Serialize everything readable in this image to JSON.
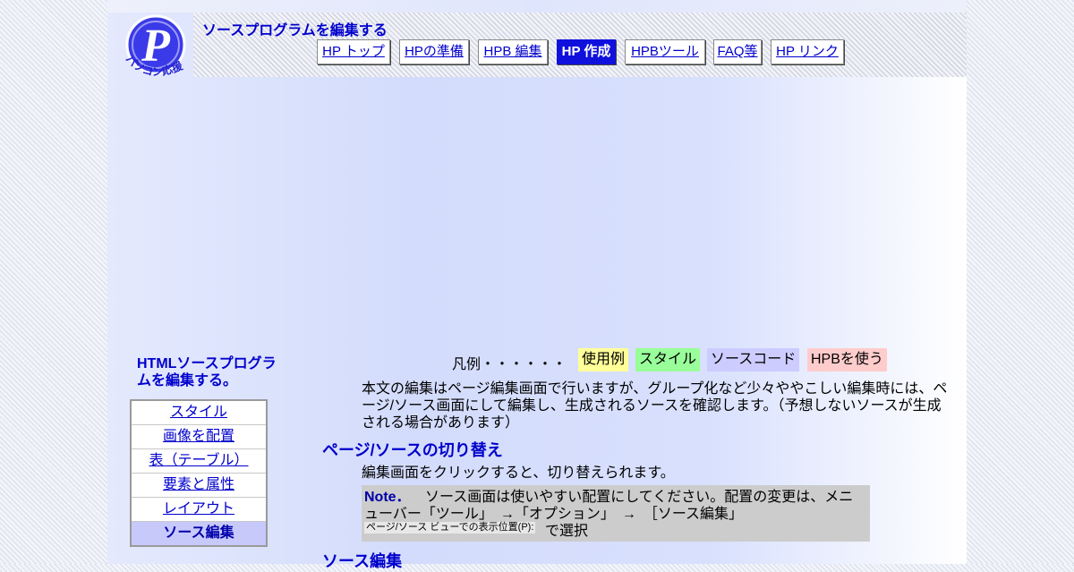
{
  "site": {
    "title": "ソースプログラムを編集する",
    "logo_text": "パソコン応援隊",
    "logo_letter": "P"
  },
  "nav": [
    {
      "label": "HP トップ",
      "active": false
    },
    {
      "label": "HPの準備",
      "active": false
    },
    {
      "label": "HPB 編集",
      "active": false
    },
    {
      "label": "HP 作成",
      "active": true
    },
    {
      "label": "HPBツール",
      "active": false
    },
    {
      "label": "FAQ等",
      "active": false
    },
    {
      "label": "HP リンク",
      "active": false
    }
  ],
  "sidebar": {
    "title": "HTMLソースプログラムを編集する。",
    "items": [
      {
        "label": "スタイル",
        "active": false
      },
      {
        "label": "画像を配置",
        "active": false
      },
      {
        "label": "表（テーブル）",
        "active": false
      },
      {
        "label": "要素と属性",
        "active": false
      },
      {
        "label": "レイアウト",
        "active": false
      },
      {
        "label": "ソース編集",
        "active": true
      }
    ]
  },
  "legend": {
    "label": "凡例・・・・・・",
    "items": [
      {
        "label": "使用例",
        "color": "#ffff99"
      },
      {
        "label": "スタイル",
        "color": "#99ff99"
      },
      {
        "label": "ソースコード",
        "color": "#ccccff"
      },
      {
        "label": "HPBを使う",
        "color": "#ffcccc"
      }
    ]
  },
  "main": {
    "intro": "本文の編集はページ編集画面で行いますが、グループ化など少々ややこしい編集時には、ページ/ソース画面にして編集し、生成されるソースを確認します。（予想しないソースが生成される場合があります）",
    "section1_heading": "ページ/ソースの切り替え",
    "section1_text": "編集画面をクリックすると、切り替えられます。",
    "note": {
      "label": "Note．",
      "line1": "ソース画面は使いやすい配置にしてください。配置の変更は、メニ",
      "line2": "ューバー「ツール」　→「オプション」　→　［ソース編集」",
      "menu_image_text": "ページ/ソース ビューでの表示位置(P):",
      "line3": "で選択"
    },
    "section2_heading": "ソース編集"
  }
}
